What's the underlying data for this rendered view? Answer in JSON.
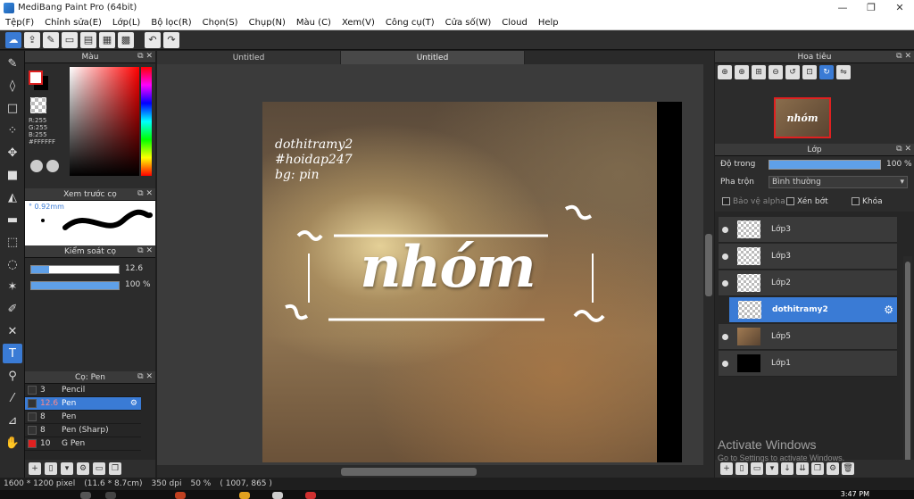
{
  "window": {
    "title": "MediBang Paint Pro (64bit)",
    "minimize": "—",
    "maximize": "❐",
    "close": "✕"
  },
  "menu": [
    "Tệp(F)",
    "Chỉnh sửa(E)",
    "Lớp(L)",
    "Bộ lọc(R)",
    "Chọn(S)",
    "Chụp(N)",
    "Màu (C)",
    "Xem(V)",
    "Công cụ(T)",
    "Cửa số(W)",
    "Cloud",
    "Help"
  ],
  "panels": {
    "color": {
      "title": "Màu",
      "r": "R:255",
      "g": "G:255",
      "b": "B:255",
      "hex": "#FFFFFF"
    },
    "brush_preview": {
      "title": "Xem trước cọ",
      "size": "° 0.92mm"
    },
    "brush_control": {
      "title": "Kiểm soát cọ",
      "size_value": "12.6",
      "opacity_value": "100 %",
      "size_fraction": 0.2,
      "opacity_fraction": 1.0
    },
    "brush_list": {
      "title": "Cọ: Pen",
      "items": [
        {
          "size": "3",
          "name": "Pencil",
          "selected": false,
          "color": "#333333"
        },
        {
          "size": "12.6",
          "name": "Pen",
          "selected": true,
          "color": "#333333"
        },
        {
          "size": "8",
          "name": "Pen",
          "selected": false,
          "color": "#333333"
        },
        {
          "size": "8",
          "name": "Pen (Sharp)",
          "selected": false,
          "color": "#333333"
        },
        {
          "size": "10",
          "name": "G Pen",
          "selected": false,
          "color": "#e02020"
        }
      ]
    },
    "navigator": {
      "title": "Hoa tiêu",
      "thumb_text": "nhóm"
    },
    "layers": {
      "title": "Lớp",
      "opacity_label": "Độ trong",
      "opacity_value": "100 %",
      "blend_label": "Pha trộn",
      "blend_value": "Bình thường",
      "protect_alpha": "Bảo vệ alpha",
      "clipping": "Xén bớt",
      "lock": "Khóa",
      "items": [
        {
          "name": "Lớp3",
          "thumb": "transparent",
          "selected": false
        },
        {
          "name": "Lớp3",
          "thumb": "transparent",
          "selected": false
        },
        {
          "name": "Lớp2",
          "thumb": "transparent",
          "selected": false
        },
        {
          "name": "dothitramy2",
          "thumb": "transparent",
          "selected": true
        },
        {
          "name": "Lớp5",
          "thumb": "photo",
          "selected": false
        },
        {
          "name": "Lớp1",
          "thumb": "black",
          "selected": false
        }
      ]
    }
  },
  "tabs": [
    "Untitled",
    "Untitled"
  ],
  "active_tab": 1,
  "canvas": {
    "credit_lines": [
      "dothitramy2",
      "#hoidap247",
      "bg: pin"
    ],
    "headline": "nhóm"
  },
  "watermark": {
    "line1": "Activate Windows",
    "line2": "Go to Settings to activate Windows."
  },
  "status": {
    "size": "1600 * 1200 pixel",
    "physical": "(11.6 * 8.7cm)",
    "dpi": "350 dpi",
    "zoom": "50 %",
    "coords": "( 1007, 865 )"
  },
  "taskbar": {
    "time": "3:47 PM"
  },
  "colors": {
    "accent": "#3a7bd5",
    "foreground": "#ffffff",
    "background": "#000000"
  }
}
